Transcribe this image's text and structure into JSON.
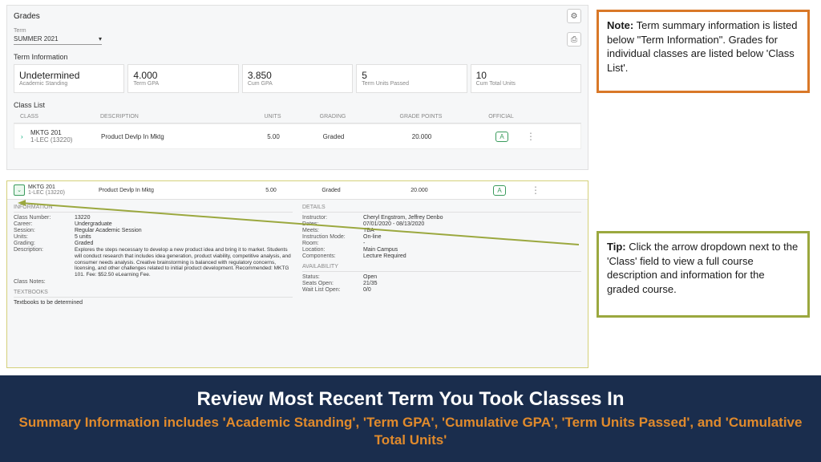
{
  "panel": {
    "title": "Grades",
    "termLabel": "Term",
    "termValue": "SUMMER 2021",
    "termInfoLabel": "Term Information",
    "classListLabel": "Class List",
    "tiles": [
      {
        "value": "Undetermined",
        "label": "Academic Standing"
      },
      {
        "value": "4.000",
        "label": "Term GPA"
      },
      {
        "value": "3.850",
        "label": "Cum GPA"
      },
      {
        "value": "5",
        "label": "Term Units Passed"
      },
      {
        "value": "10",
        "label": "Cum Total Units"
      }
    ],
    "cols": {
      "class": "CLASS",
      "desc": "DESCRIPTION",
      "units": "UNITS",
      "grading": "GRADING",
      "gp": "GRADE POINTS",
      "official": "OFFICIAL"
    },
    "row": {
      "class": "MKTG 201",
      "section": "1-LEC (13220)",
      "desc": "Product Devlp In Mktg",
      "units": "5.00",
      "grading": "Graded",
      "gp": "20.000",
      "official": "A"
    }
  },
  "expanded": {
    "row": {
      "class": "MKTG 201",
      "section": "1-LEC (13220)",
      "desc": "Product Devlp In Mktg",
      "units": "5.00",
      "grading": "Graded",
      "gp": "20.000",
      "official": "A"
    },
    "info": {
      "title": "INFORMATION",
      "items": [
        {
          "k": "Class Number:",
          "v": "13220"
        },
        {
          "k": "Career:",
          "v": "Undergraduate"
        },
        {
          "k": "Session:",
          "v": "Regular Academic Session"
        },
        {
          "k": "Units:",
          "v": "5 units"
        },
        {
          "k": "Grading:",
          "v": "Graded"
        },
        {
          "k": "Description:",
          "v": "Explores the steps necessary to develop a new product idea and bring it to market. Students will conduct research that includes idea generation, product viability, competitive analysis, and consumer needs analysis. Creative brainstorming is balanced with regulatory concerns, licensing, and other challenges related to initial product development. Recommended: MKTG 101. Fee: $52.50 eLearning Fee."
        },
        {
          "k": "Class Notes:",
          "v": ""
        }
      ]
    },
    "details": {
      "title": "DETAILS",
      "items": [
        {
          "k": "Instructor:",
          "v": "Cheryl Engstrom, Jeffrey Denbo"
        },
        {
          "k": "Dates:",
          "v": "07/01/2020 - 08/13/2020"
        },
        {
          "k": "Meets:",
          "v": "TBA"
        },
        {
          "k": "Instruction Mode:",
          "v": "On-line"
        },
        {
          "k": "Room:",
          "v": "-"
        },
        {
          "k": "Location:",
          "v": "Main Campus"
        },
        {
          "k": "Components:",
          "v": "Lecture Required"
        }
      ]
    },
    "textbooks": {
      "title": "TEXTBOOKS",
      "text": "Textbooks to be determined"
    },
    "availability": {
      "title": "AVAILABILITY",
      "items": [
        {
          "k": "Status:",
          "v": "Open"
        },
        {
          "k": "Seats Open:",
          "v": "21/35"
        },
        {
          "k": "Wait List Open:",
          "v": "0/0"
        }
      ]
    }
  },
  "note": {
    "label": "Note:",
    "text": " Term summary information is listed below \"Term Information\". Grades for individual classes are listed below 'Class List'."
  },
  "tip": {
    "label": "Tip:",
    "text": " Click the arrow dropdown next to the 'Class' field to view a full course description and information for the graded course."
  },
  "footer": {
    "line1": "Review Most Recent Term You Took Classes In",
    "line2": "Summary Information includes 'Academic Standing', 'Term GPA', 'Cumulative GPA', 'Term Units Passed', and 'Cumulative Total Units'"
  }
}
